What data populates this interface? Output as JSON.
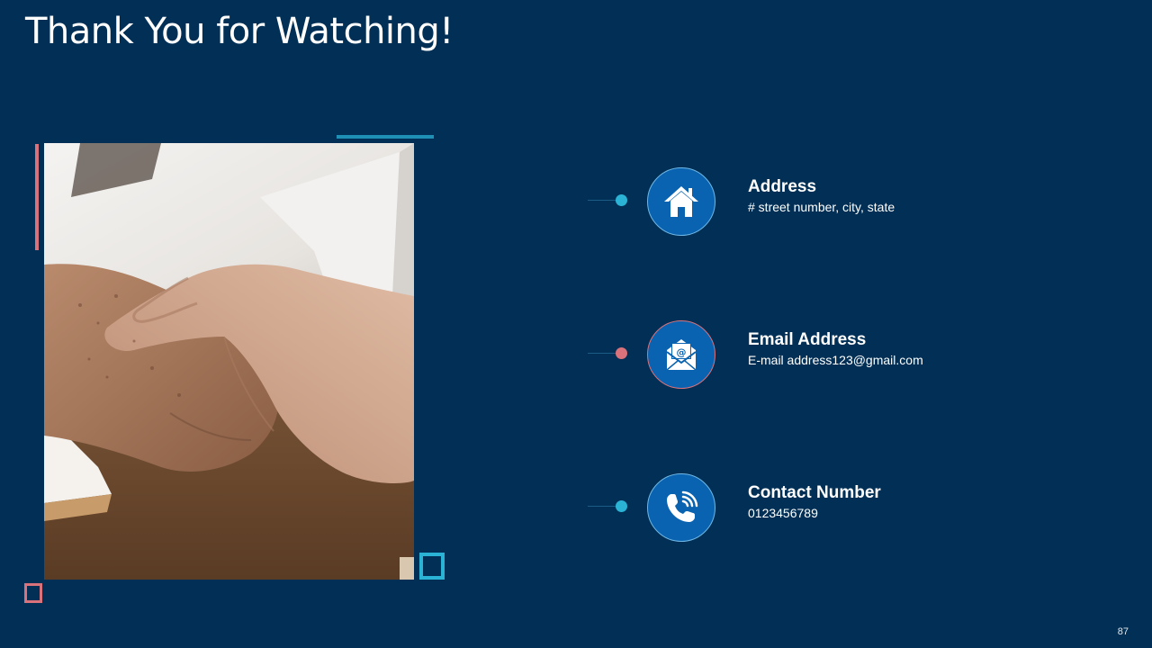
{
  "slide": {
    "title": "Thank You for Watching!",
    "page_number": "87"
  },
  "colors": {
    "background": "#012f55",
    "icon_fill": "#0a63b0",
    "accent_teal": "#2bb3d6",
    "accent_pink": "#d9727a"
  },
  "photo": {
    "subject": "handshake-photo"
  },
  "contacts": [
    {
      "icon": "home-icon",
      "heading": "Address",
      "detail": "# street number, city, state",
      "dot_color": "#2bb3d6"
    },
    {
      "icon": "email-icon",
      "heading": "Email Address",
      "detail": "E-mail address123@gmail.com",
      "dot_color": "#d9727a"
    },
    {
      "icon": "phone-icon",
      "heading": "Contact Number",
      "detail": "0123456789",
      "dot_color": "#2bb3d6"
    }
  ]
}
